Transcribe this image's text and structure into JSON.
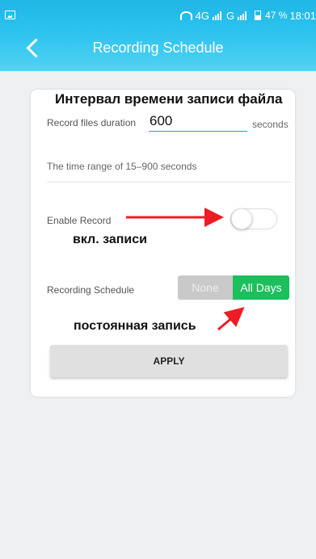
{
  "status_bar": {
    "network_label": "4G",
    "network_label_2": "G",
    "battery": "47 %",
    "time": "18:01",
    "icons": [
      "image-icon",
      "wifi-icon",
      "signal-icon",
      "battery-icon"
    ]
  },
  "header": {
    "title": "Recording Schedule",
    "back_icon": "chevron-left-icon"
  },
  "form": {
    "duration_label": "Record files duration",
    "duration_value": "600",
    "duration_unit": "seconds",
    "range_hint": "The time range of 15–900 seconds",
    "enable_label": "Enable Record",
    "enable_on": false,
    "schedule_label": "Recording Schedule",
    "schedule_options": [
      "None",
      "All Days"
    ],
    "schedule_selected": "All Days",
    "apply_label": "APPLY"
  },
  "annotations": {
    "title": "Интервал времени записи файла",
    "enable": "вкл. записи",
    "schedule": "постоянная запись"
  },
  "colors": {
    "header_gradient_top": "#1fb6e6",
    "header_gradient_bottom": "#52d2f3",
    "selected_segment": "#1bbf5c",
    "unselected_segment": "#c9c9c9",
    "input_underline": "#1aa7b5",
    "annotation_arrow": "#ee1c24"
  }
}
